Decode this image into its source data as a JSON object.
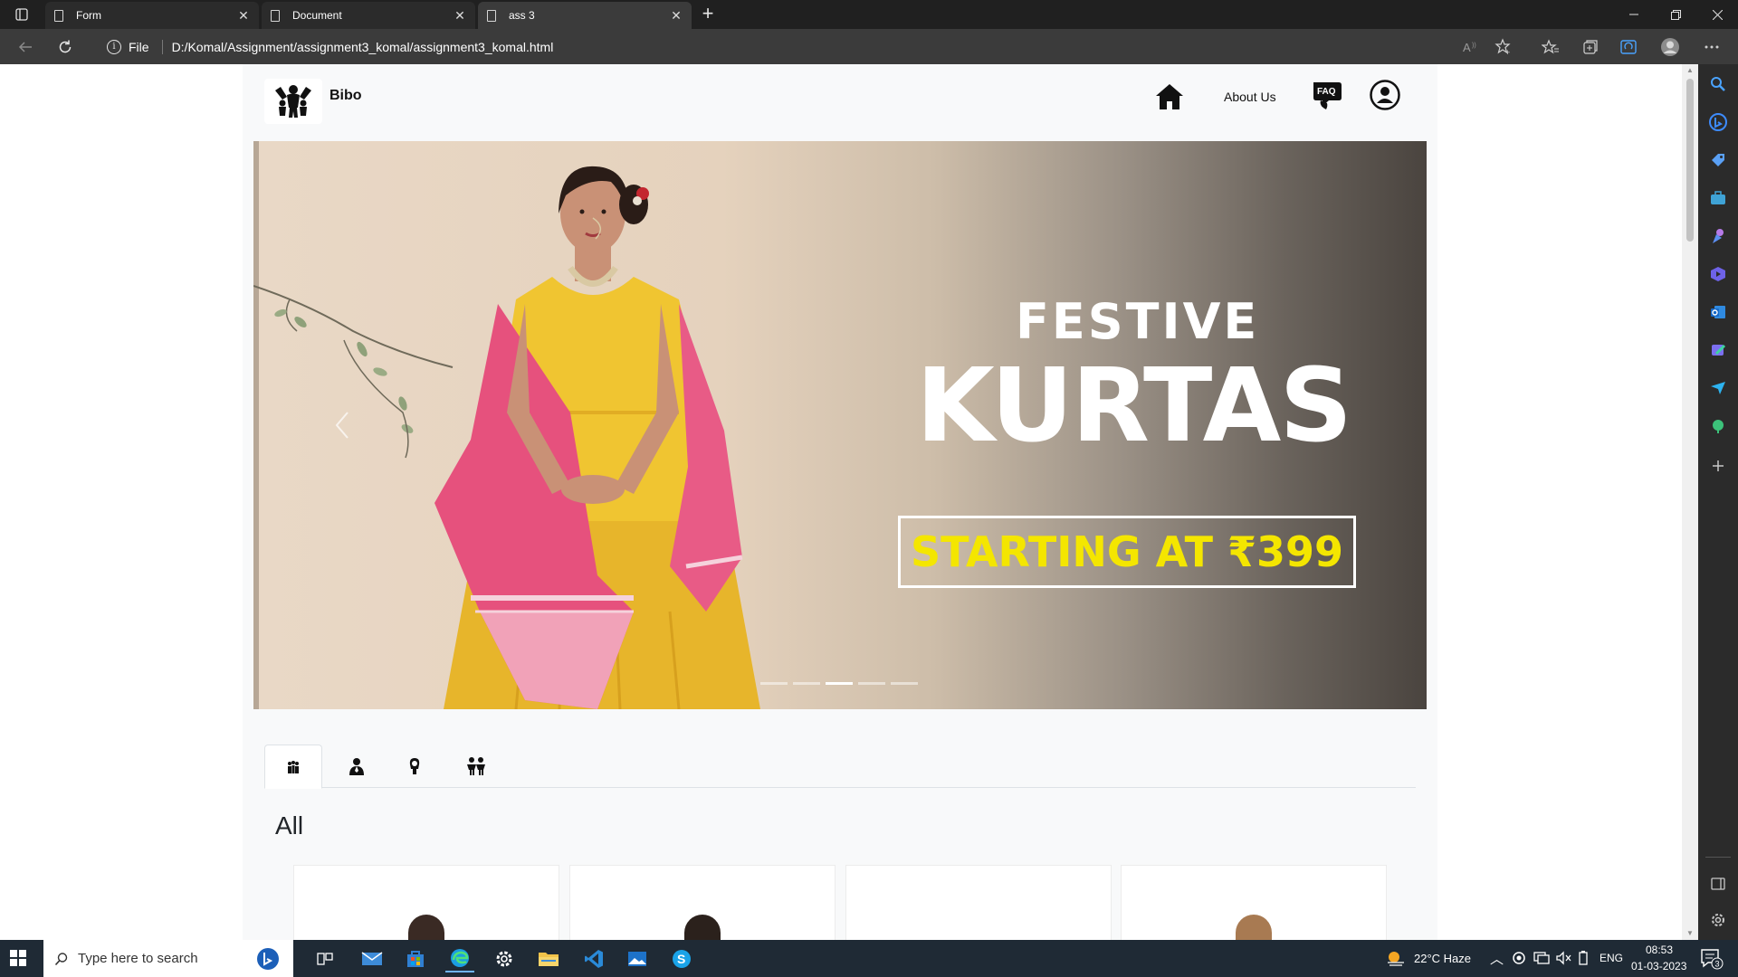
{
  "browser": {
    "tabs": [
      {
        "title": "Form"
      },
      {
        "title": "Document"
      },
      {
        "title": "ass 3"
      }
    ],
    "address": {
      "scheme_label": "File",
      "url": "D:/Komal/Assignment/assignment3_komal/assignment3_komal.html"
    }
  },
  "site": {
    "brand": "Bibo",
    "nav": {
      "about_label": "About Us",
      "faq_label": "FAQ"
    },
    "hero": {
      "line1": "FESTIVE",
      "line2": "KURTAS",
      "offer": "STARTING AT ₹399",
      "slide_count": 5,
      "active_slide": 3
    },
    "category_tabs": [
      "all-users-icon",
      "single-user-icon",
      "female-icon",
      "children-icon"
    ],
    "section_title": "All"
  },
  "taskbar": {
    "search_placeholder": "Type here to search",
    "weather": "22°C  Haze",
    "language": "ENG",
    "time": "08:53",
    "date": "01-03-2023",
    "notification_count": "3"
  },
  "colors": {
    "offer_yellow": "#f4e600",
    "page_bg": "#f8f9fa",
    "browser_dark": "#202020"
  }
}
